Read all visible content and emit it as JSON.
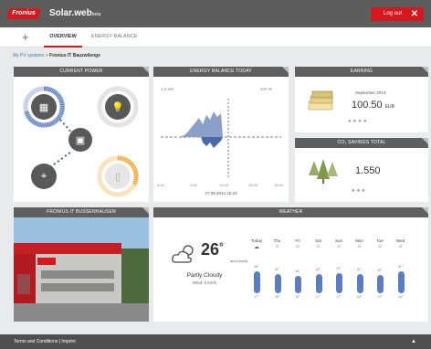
{
  "header": {
    "logo_text": "Fronius",
    "app_title": "Solar.web",
    "app_suffix": "beta",
    "logout_label": "Log out"
  },
  "tabs": [
    {
      "label": "OVERVIEW"
    },
    {
      "label": "ENERGY BALANCE"
    }
  ],
  "breadcrumb": {
    "link": "My PV systems",
    "separator": ">",
    "current": "Fronius IT Bauzwilenge"
  },
  "panels": {
    "current_power": {
      "title": "CURRENT POWER"
    },
    "energy_balance": {
      "title": "ENERGY BALANCE TODAY",
      "y_left": "1.0 kW",
      "y_right": "400 W",
      "x_ticks": [
        "6:00",
        "9:00",
        "12:00",
        "15:00",
        "18:00"
      ],
      "date_label": "27.08.2014 15:20"
    },
    "earning": {
      "title": "EARNING",
      "period": "September 2014",
      "value": "100.50",
      "currency": "EUR"
    },
    "co2": {
      "title": "CO₂ SAVINGS TOTAL",
      "value": "1.550"
    },
    "photo": {
      "title": "FRONIUS IT BUSSENHAUSEN"
    },
    "weather": {
      "title": "WEATHER",
      "temperature": "26",
      "unit": "°",
      "subtext": "and cloudy",
      "condition": "Partly Cloudy",
      "wind": "Wind: 5 km/h",
      "forecast": [
        {
          "day": "Today",
          "hi": "28°",
          "lo": "17°",
          "level": 0.72
        },
        {
          "day": "Thu",
          "hi": "31°",
          "lo": "18°",
          "level": 0.62
        },
        {
          "day": "Fri",
          "hi": "26°",
          "lo": "16°",
          "level": 0.55
        },
        {
          "day": "Sat",
          "hi": "29°",
          "lo": "17°",
          "level": 0.62
        },
        {
          "day": "Sun",
          "hi": "31°",
          "lo": "17°",
          "level": 0.66
        },
        {
          "day": "Mon",
          "hi": "31°",
          "lo": "18°",
          "level": 0.62
        },
        {
          "day": "Tue",
          "hi": "30°",
          "lo": "17°",
          "level": 0.6
        },
        {
          "day": "Wed",
          "hi": "31°",
          "lo": "16°",
          "level": 0.7
        }
      ]
    }
  },
  "footer": {
    "text": "Terms and Conditions | Imprint"
  },
  "colors": {
    "brand_red": "#d8161d",
    "panel_header": "#5f5f5f",
    "accent_blue": "#3d5fae",
    "accent_orange": "#f4a636"
  }
}
